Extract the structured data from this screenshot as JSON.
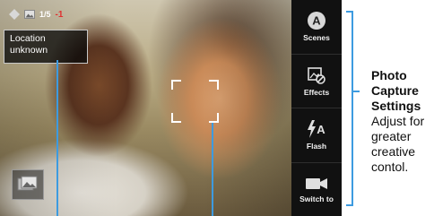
{
  "viewfinder": {
    "status": {
      "icons": [
        "tag-icon",
        "gallery-icon"
      ],
      "count_label": "1/5",
      "count_value": "-1"
    },
    "location_text": "Location unknown"
  },
  "controls": [
    {
      "label": "Scenes",
      "icon": "scenes-icon"
    },
    {
      "label": "Effects",
      "icon": "effects-icon"
    },
    {
      "label": "Flash",
      "icon": "flash-icon"
    },
    {
      "label": "Switch to",
      "icon": "video-camera-icon"
    }
  ],
  "annotation": {
    "title": "Photo Capture Settings",
    "body": "Adjust for greater creative contol."
  },
  "colors": {
    "accent": "#3d9be0",
    "panel": "#111111"
  }
}
